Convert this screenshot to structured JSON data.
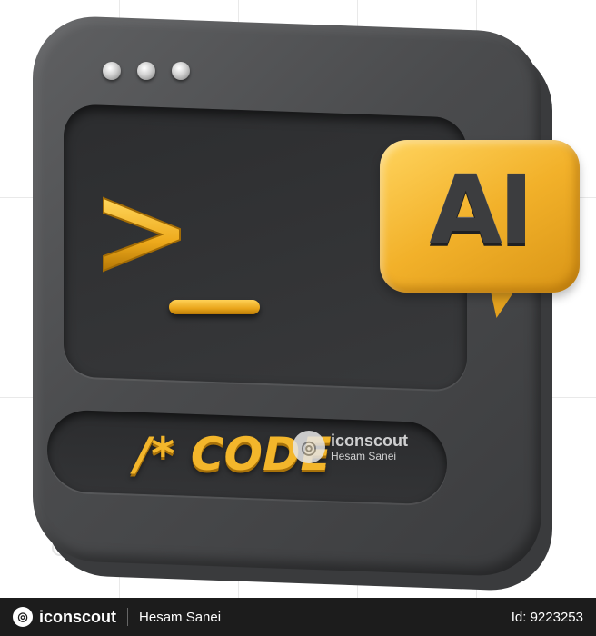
{
  "illustration": {
    "terminal_prompt": ">_",
    "code_label": "/* CODE",
    "bubble_label": "AI",
    "accent_color": "#f3b62b",
    "body_color": "#4a4b4d",
    "icons": [
      "window-dots",
      "terminal-prompt-icon",
      "speech-bubble-icon"
    ]
  },
  "watermark": {
    "brand": "iconscout",
    "author": "Hesam Sanei"
  },
  "footer": {
    "brand": "iconscout",
    "author": "Hesam Sanei",
    "id_text": "Id: 9223253"
  }
}
